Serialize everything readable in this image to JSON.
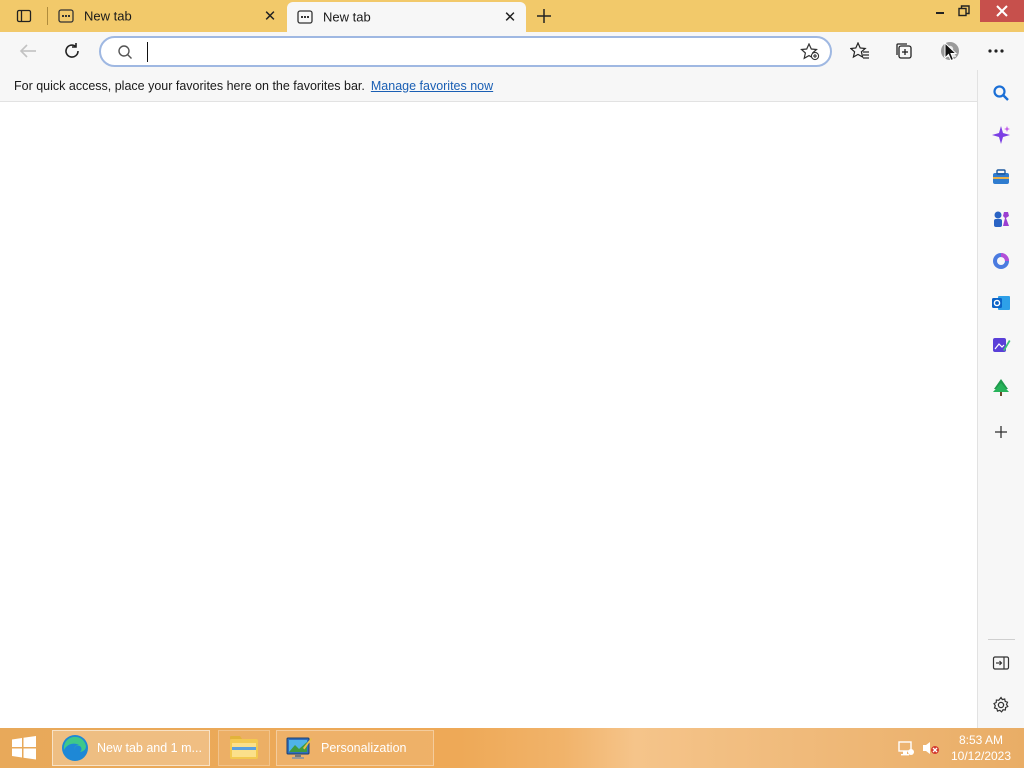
{
  "browser": {
    "tabs": [
      {
        "label": "New tab",
        "active": false
      },
      {
        "label": "New tab",
        "active": true
      }
    ],
    "address": {
      "value": "",
      "placeholder": ""
    },
    "favorites_bar": {
      "message": "For quick access, place your favorites here on the favorites bar.",
      "link": "Manage favorites now"
    },
    "sidebar_icons": [
      "search-icon",
      "copilot-icon",
      "tools-icon",
      "games-icon",
      "office-icon",
      "outlook-icon",
      "designer-icon",
      "tree-icon",
      "add-icon"
    ],
    "sidebar_bottom_icons": [
      "hide-sidebar-icon",
      "settings-icon"
    ]
  },
  "taskbar": {
    "items": [
      {
        "label": "New tab and 1 m...",
        "icon": "edge-icon"
      },
      {
        "label": "",
        "icon": "file-explorer-icon"
      },
      {
        "label": "Personalization",
        "icon": "personalization-icon"
      }
    ],
    "clock": {
      "time": "8:53 AM",
      "date": "10/12/2023"
    }
  },
  "colors": {
    "titlebar": "#f2c96a",
    "taskbar": "#eea957",
    "link": "#1a5fb4",
    "close_hover": "#c7504c"
  }
}
